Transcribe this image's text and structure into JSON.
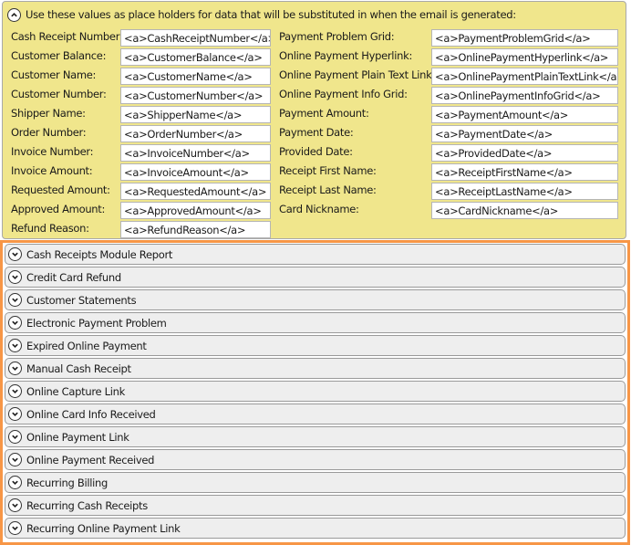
{
  "header": {
    "text": "Use these values as place holders for data that will be substituted in when the email is generated:",
    "icon": "chevron-up-icon"
  },
  "left_fields": [
    {
      "label": "Cash Receipt Number:",
      "value": "<a>CashReceiptNumber</a>"
    },
    {
      "label": "Customer Balance:",
      "value": "<a>CustomerBalance</a>"
    },
    {
      "label": "Customer Name:",
      "value": "<a>CustomerName</a>"
    },
    {
      "label": "Customer Number:",
      "value": "<a>CustomerNumber</a>"
    },
    {
      "label": "Shipper Name:",
      "value": "<a>ShipperName</a>"
    },
    {
      "label": "Order Number:",
      "value": "<a>OrderNumber</a>"
    },
    {
      "label": "Invoice Number:",
      "value": "<a>InvoiceNumber</a>"
    },
    {
      "label": "Invoice Amount:",
      "value": "<a>InvoiceAmount</a>"
    },
    {
      "label": "Requested Amount:",
      "value": "<a>RequestedAmount</a>"
    },
    {
      "label": "Approved Amount:",
      "value": "<a>ApprovedAmount</a>"
    },
    {
      "label": "Refund Reason:",
      "value": "<a>RefundReason</a>"
    }
  ],
  "right_fields": [
    {
      "label": "Payment Problem Grid:",
      "value": "<a>PaymentProblemGrid</a>"
    },
    {
      "label": "Online Payment Hyperlink:",
      "value": "<a>OnlinePaymentHyperlink</a>"
    },
    {
      "label": "Online Payment Plain Text Link:",
      "value": "<a>OnlinePaymentPlainTextLink</a>"
    },
    {
      "label": "Online Payment Info Grid:",
      "value": "<a>OnlinePaymentInfoGrid</a>"
    },
    {
      "label": "Payment Amount:",
      "value": "<a>PaymentAmount</a>"
    },
    {
      "label": "Payment Date:",
      "value": "<a>PaymentDate</a>"
    },
    {
      "label": "Provided Date:",
      "value": "<a>ProvidedDate</a>"
    },
    {
      "label": "Receipt First Name:",
      "value": "<a>ReceiptFirstName</a>"
    },
    {
      "label": "Receipt Last Name:",
      "value": "<a>ReceiptLastName</a>"
    },
    {
      "label": "Card Nickname:",
      "value": "<a>CardNickname</a>"
    }
  ],
  "sections": [
    "Cash Receipts Module Report",
    "Credit Card Refund",
    "Customer Statements",
    "Electronic Payment Problem",
    "Expired Online Payment",
    "Manual Cash Receipt",
    "Online Capture Link",
    "Online Card Info Received",
    "Online Payment Link",
    "Online Payment Received",
    "Recurring Billing",
    "Recurring Cash Receipts",
    "Recurring Online Payment Link"
  ],
  "colors": {
    "panel": "#f0e68c",
    "highlight_border": "#f79646",
    "row_bg": "#eeeeee"
  }
}
